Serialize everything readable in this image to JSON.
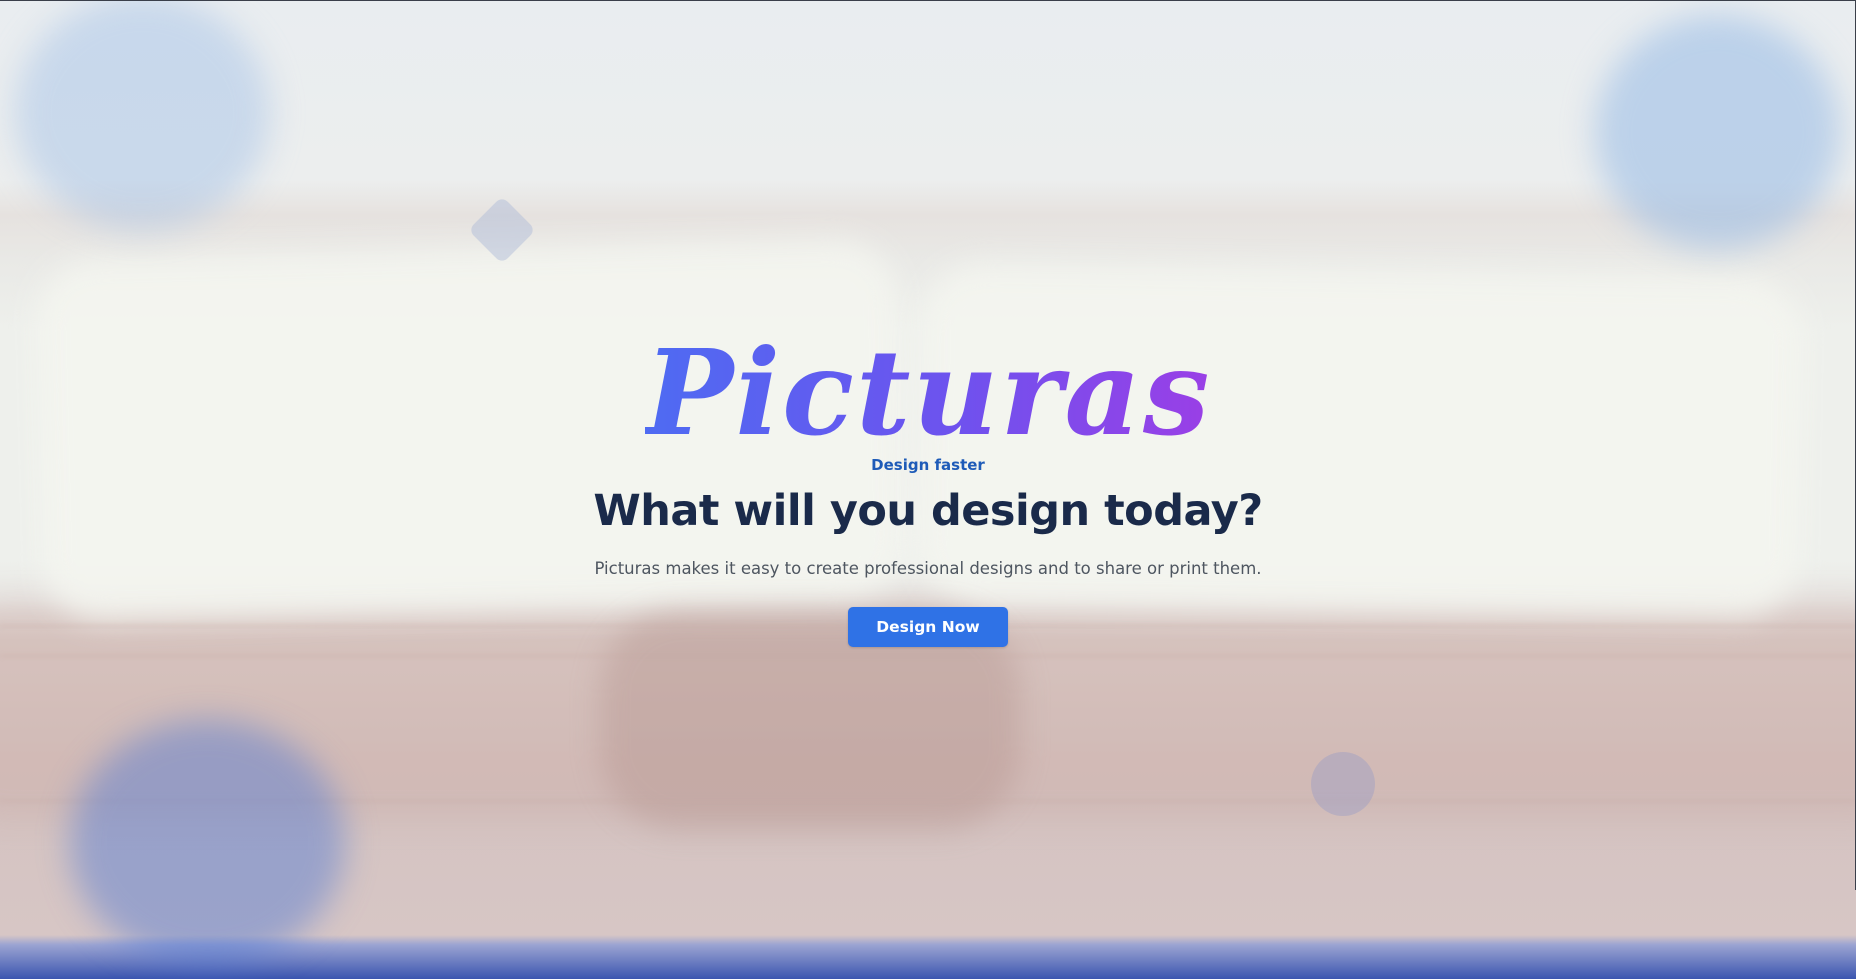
{
  "hero": {
    "logo_text": "Picturas",
    "tagline": "Design faster",
    "headline": "What will you design today?",
    "description": "Picturas makes it easy to create professional designs and to share or print them.",
    "cta_label": "Design Now"
  },
  "colors": {
    "logo_gradient_start": "#4e6bf2",
    "logo_gradient_end": "#9a3fe6",
    "tagline": "#1e5bb8",
    "headline": "#1a2a4a",
    "cta_background": "#2f72e6",
    "bottom_band": "#3b55b0"
  },
  "decorations": {
    "background_image": "blurred-open-book-photo",
    "shapes": [
      "circle-blob",
      "circle-blob",
      "circle-blob",
      "circle-dot",
      "diamond"
    ]
  }
}
